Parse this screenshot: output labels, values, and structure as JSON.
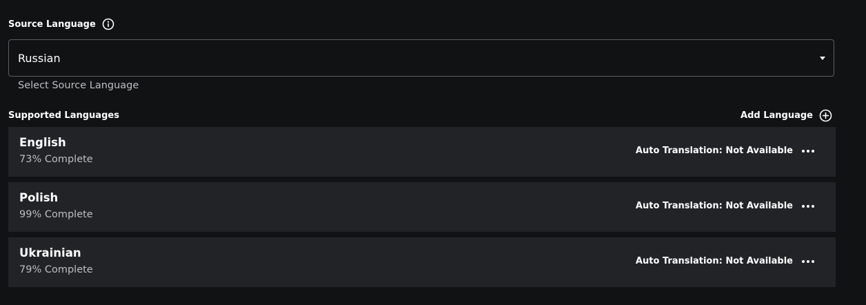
{
  "source_language": {
    "header_label": "Source Language",
    "info_icon": "info-circle-icon",
    "selected_value": "Russian",
    "helper_text": "Select Source Language",
    "caret_icon": "caret-down-icon"
  },
  "supported_languages": {
    "header_label": "Supported Languages",
    "add_label": "Add Language",
    "add_icon": "plus-circle-icon",
    "items": [
      {
        "name": "English",
        "progress": "73% Complete",
        "progress_percent": 73,
        "auto_translation": "Auto Translation: Not Available"
      },
      {
        "name": "Polish",
        "progress": "99% Complete",
        "progress_percent": 99,
        "auto_translation": "Auto Translation: Not Available"
      },
      {
        "name": "Ukrainian",
        "progress": "79% Complete",
        "progress_percent": 79,
        "auto_translation": "Auto Translation: Not Available"
      }
    ]
  },
  "colors": {
    "background": "#111214",
    "row_background": "#222327",
    "border": "#5b5d62",
    "text_primary": "#ffffff",
    "text_secondary": "#bdbec2"
  }
}
